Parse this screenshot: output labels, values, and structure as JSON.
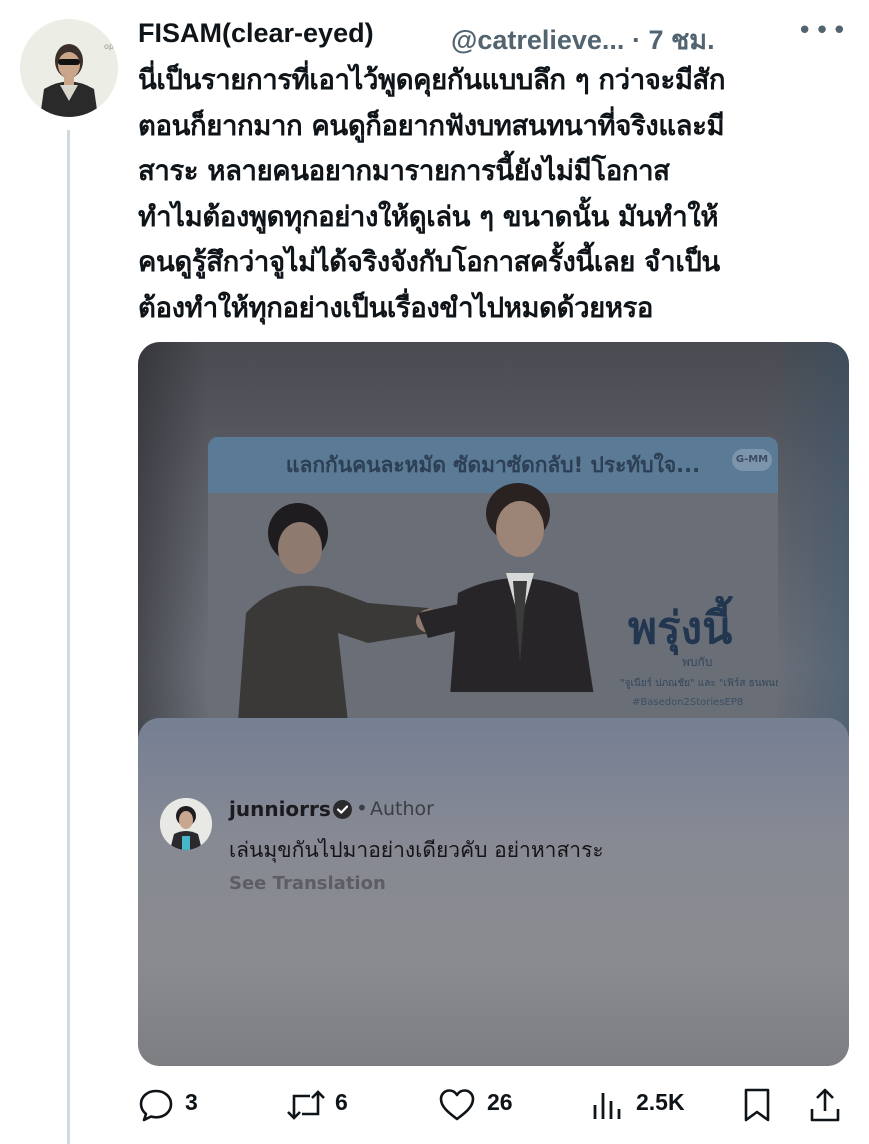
{
  "tweet": {
    "display_name": "FISAM(clear-eyed)",
    "handle": "@catrelieve...",
    "time": "· 7 ชม.",
    "more_icon": "more-dots-icon",
    "text_lines": [
      "นี่เป็นรายการที่เอาไว้พูดคุยกันแบบลึก ๆ กว่าจะมีสัก",
      "ตอนก็ยากมาก คนดูก็อยากฟังบทสนทนาที่จริงและมี",
      "สาระ หลายคนอยากมารายการนี้ยังไม่มีโอกาส",
      "ทำไมต้องพูดทุกอย่างให้ดูเล่น ๆ ขนาดนั้น มันทำให้",
      "คนดูรู้สึกว่าจูไม่ได้จริงจังกับโอกาสครั้งนี้เลย จำเป็น",
      "ต้องทำให้ทุกอย่างเป็นเรื่องขำไปหมดด้วยหรอ"
    ]
  },
  "media": {
    "poster_banner": "แลกกันคนละหมัด ซัดมาซัดกลับ! ประทับใจ...",
    "poster_logo": "G-MM",
    "poster_headline": "พรุ่งนี้",
    "poster_sub": "พบกับ",
    "poster_credit": "\"จูเนียร์ ปภณชัย\" และ \"เฟิร์ส ธนพนธ์\"",
    "poster_hashtag": "#Basedon2StoriesEP8",
    "comment": {
      "username": "junniorrs",
      "badge_icon": "verified-check-icon",
      "separator": "•",
      "role": "Author",
      "text": "เล่นมุขกันไปมาอย่างเดียวคับ อย่าหาสาระ",
      "translate_label": "See Translation"
    }
  },
  "actions": {
    "reply_count": "3",
    "repost_count": "6",
    "like_count": "26",
    "views_count": "2.5K",
    "icons": [
      "reply-icon",
      "repost-icon",
      "like-icon",
      "views-icon",
      "bookmark-icon",
      "share-icon"
    ]
  },
  "colors": {
    "text": "#0f1419",
    "secondary": "#536471",
    "thread_line": "#cfd9de"
  }
}
